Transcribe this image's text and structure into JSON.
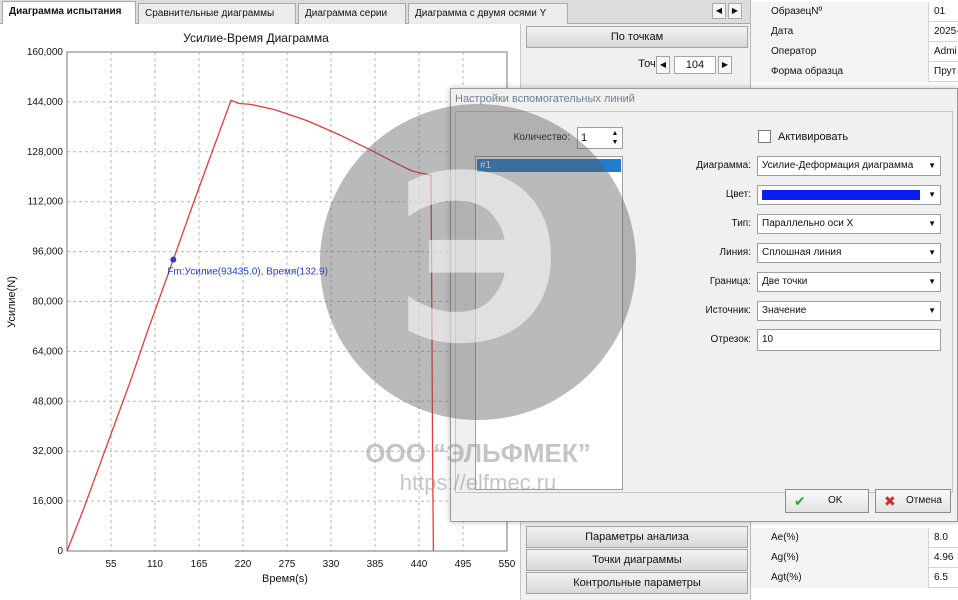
{
  "tabs": [
    {
      "label": "Диаграмма испытания",
      "active": true
    },
    {
      "label": "Сравнительные диаграммы",
      "active": false
    },
    {
      "label": "Диаграмма серии",
      "active": false
    },
    {
      "label": "Диаграмма с двумя осями Y",
      "active": false
    }
  ],
  "tab_nav": {
    "left_icon": "chevron-left-icon",
    "right_icon": "chevron-right-icon"
  },
  "chart_data": {
    "type": "line",
    "title": "Усилие-Время Диаграмма",
    "xlabel": "Время(s)",
    "ylabel": "Усилие(N)",
    "xlim": [
      0,
      550
    ],
    "ylim": [
      0,
      160000
    ],
    "x_ticks": [
      "55",
      "110",
      "165",
      "220",
      "275",
      "330",
      "385",
      "440",
      "495",
      "550"
    ],
    "y_ticks": [
      "0",
      "16,000",
      "32,000",
      "48,000",
      "64,000",
      "80,000",
      "96,000",
      "112,000",
      "128,000",
      "144,000",
      "160,000"
    ],
    "grid": true,
    "series": [
      {
        "color": "#e83a3a",
        "x": [
          0,
          20,
          40,
          60,
          80,
          100,
          132.9,
          160,
          180,
          200,
          205,
          210,
          215,
          230,
          260,
          300,
          340,
          380,
          410,
          430,
          437,
          455,
          456,
          457,
          458
        ],
        "y": [
          0,
          13000,
          27000,
          41000,
          55000,
          70000,
          93435,
          113000,
          127000,
          141000,
          144500,
          144000,
          143500,
          143200,
          141500,
          138000,
          133500,
          128500,
          124500,
          122000,
          121500,
          120500,
          80000,
          30000,
          0
        ]
      }
    ],
    "marker": {
      "x": 132.9,
      "y": 93435,
      "color": "#1f3fd6"
    },
    "annotation": {
      "text": "Fm:Усилие(93435.0), Время(132.9)",
      "color": "#1f3fd6"
    }
  },
  "side": {
    "by_points_label": "По точкам",
    "point_label": "Точка:",
    "point_value": "104",
    "spin_left_icon": "chevron-left-icon",
    "spin_right_icon": "chevron-right-icon",
    "bottom_buttons": [
      "Параметры анализа",
      "Точки диаграммы",
      "Контрольные параметры"
    ]
  },
  "props_top": [
    {
      "key": "ОбразецNº",
      "value": "01"
    },
    {
      "key": "Дата",
      "value": "2025-"
    },
    {
      "key": "Оператор",
      "value": "Admi"
    },
    {
      "key": "Форма образца",
      "value": "Прут"
    }
  ],
  "props_bottom": [
    {
      "key": "Ae(%)",
      "value": "8.0"
    },
    {
      "key": "Ag(%)",
      "value": "4.96"
    },
    {
      "key": "Agt(%)",
      "value": "6.5"
    }
  ],
  "dialog": {
    "title": "Настройки вспомогательных линий",
    "quantity_label": "Количество:",
    "quantity_value": "1",
    "list_items": [
      "#1"
    ],
    "activate_label": "Активировать",
    "fields": [
      {
        "label": "Диаграмма:",
        "value": "Усилие-Деформация диаграмма"
      },
      {
        "label": "Цвет:",
        "value": "",
        "color": "#0a1ef0"
      },
      {
        "label": "Тип:",
        "value": "Параллельно оси X"
      },
      {
        "label": "Линия:",
        "value": "Сплошная линия"
      },
      {
        "label": "Граница:",
        "value": "Две точки"
      },
      {
        "label": "Источник:",
        "value": "Значение"
      }
    ],
    "segment_label": "Отрезок:",
    "segment_value": "10",
    "ok_label": "OK",
    "cancel_label": "Отмена",
    "ok_icon": "checkmark-icon",
    "cancel_icon": "close-icon"
  },
  "watermark": {
    "company": "ООО “ЭЛЬФМЕК”",
    "url": "https://elfmec.ru",
    "logo_icon": "elfmec-logo-icon"
  }
}
